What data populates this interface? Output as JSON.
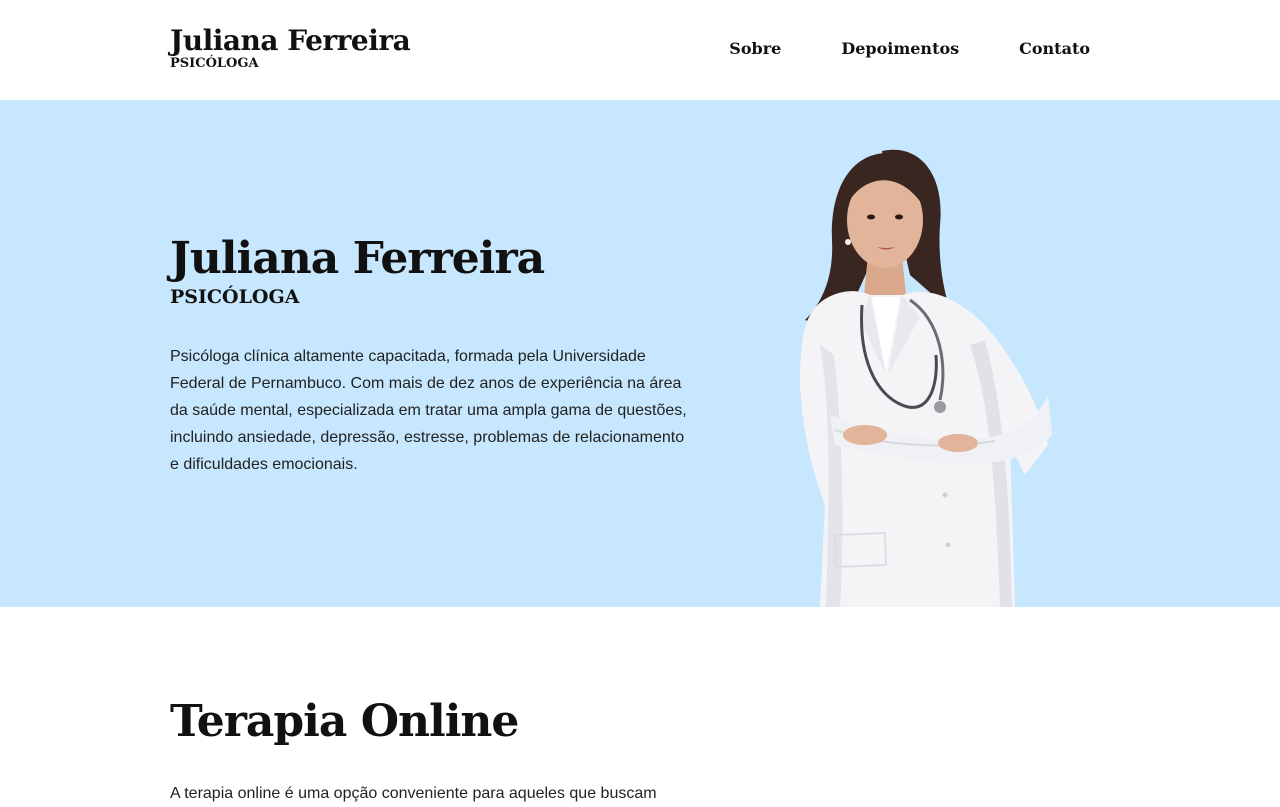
{
  "header": {
    "brand_name": "Juliana Ferreira",
    "brand_subtitle": "PSICÓLOGA",
    "nav": [
      {
        "label": "Sobre"
      },
      {
        "label": "Depoimentos"
      },
      {
        "label": "Contato"
      }
    ]
  },
  "hero": {
    "name": "Juliana Ferreira",
    "subtitle": "PSICÓLOGA",
    "description": "Psicóloga clínica altamente capacitada, formada pela Universidade Federal de Pernambuco. Com mais de dez anos de experiência na área da saúde mental, especializada em tratar uma ampla gama de questões, incluindo ansiedade, depressão, estresse, problemas de relacionamento e dificuldades emocionais.",
    "background_color": "#c6e7fd"
  },
  "therapy": {
    "title": "Terapia Online",
    "text": "A terapia online é uma opção conveniente para aqueles que buscam"
  }
}
